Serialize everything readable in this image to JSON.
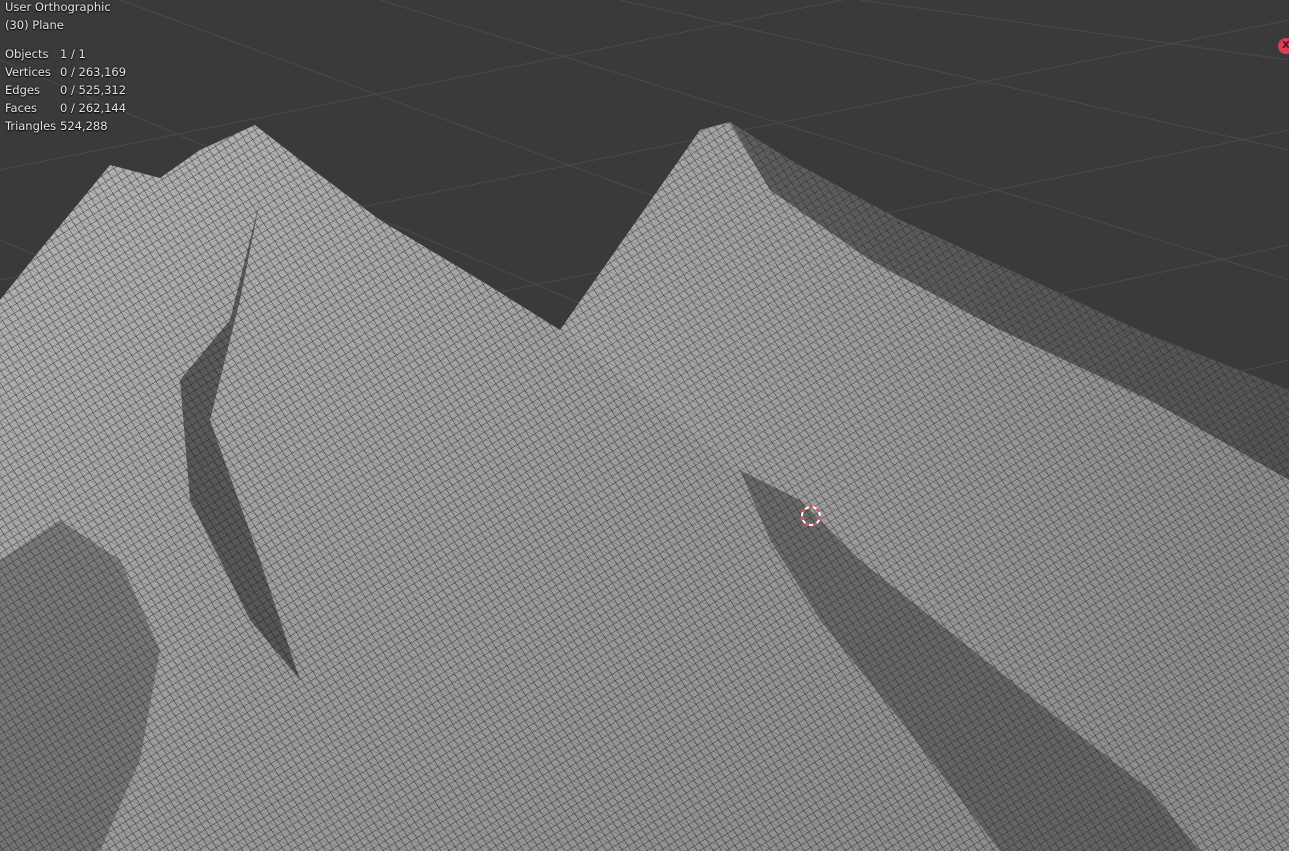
{
  "viewport": {
    "view_name": "User Orthographic",
    "active_object": "(30) Plane",
    "background_color": "#3a3a3a",
    "grid_color": "#4a4a4a",
    "mesh_fill_color": "#9e9e9e",
    "wire_color": "#141414",
    "view_mode": "wireframe-overlay"
  },
  "statistics": [
    {
      "label": "Objects",
      "value": "1 / 1"
    },
    {
      "label": "Vertices",
      "value": "0 / 263,169"
    },
    {
      "label": "Edges",
      "value": "0 / 525,312"
    },
    {
      "label": "Faces",
      "value": "0 / 262,144"
    },
    {
      "label": "Triangles",
      "value": "524,288"
    }
  ],
  "gizmo": {
    "axis_label": "X",
    "axis_color": "#dd3c55"
  },
  "cursor": {
    "icon": "3d-cursor-icon",
    "colors": [
      "#e8424f",
      "#ffffff"
    ]
  }
}
